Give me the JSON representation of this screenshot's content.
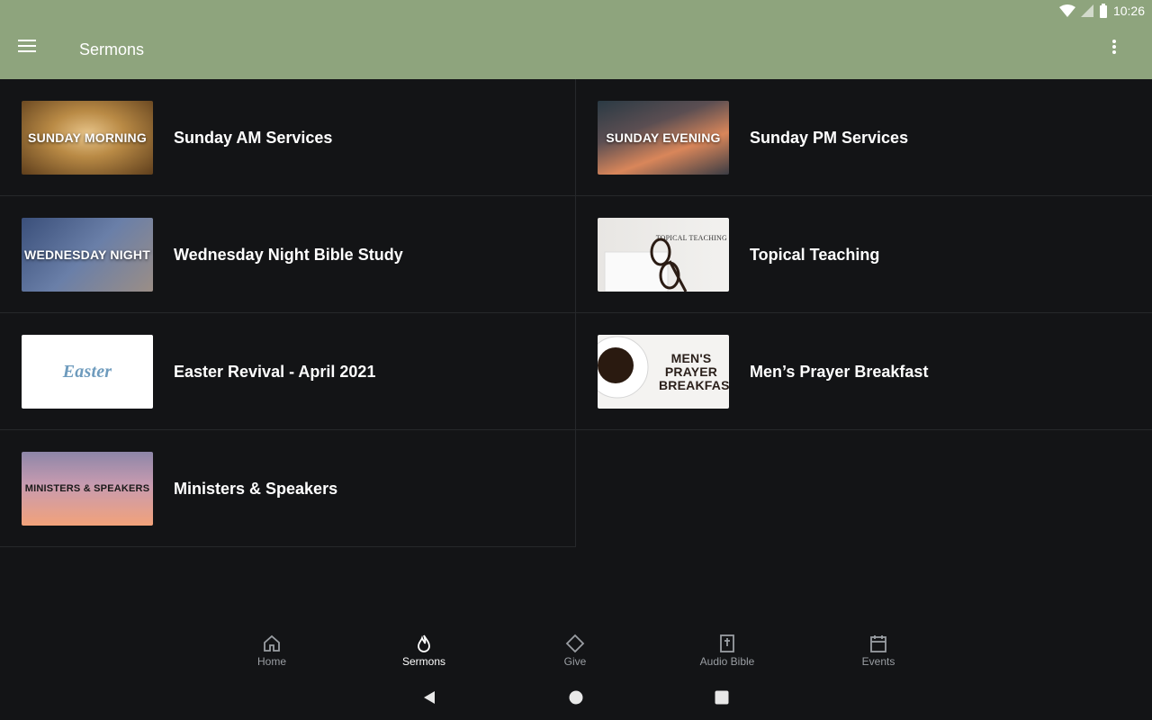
{
  "status": {
    "time": "10:26"
  },
  "appbar": {
    "title": "Sermons"
  },
  "items": [
    {
      "title": "Sunday AM Services",
      "thumb_text": "SUNDAY MORNING"
    },
    {
      "title": "Sunday PM Services",
      "thumb_text": "SUNDAY EVENING"
    },
    {
      "title": "Wednesday Night Bible Study",
      "thumb_text": "WEDNESDAY NIGHT"
    },
    {
      "title": "Topical Teaching",
      "thumb_text": "TOPICAL TEACHING"
    },
    {
      "title": "Easter Revival - April 2021",
      "thumb_text": "Easter"
    },
    {
      "title": "Men’s Prayer Breakfast",
      "thumb_text": "MEN'S PRAYER BREAKFAST"
    },
    {
      "title": "Ministers & Speakers",
      "thumb_text": "MINISTERS & SPEAKERS"
    }
  ],
  "bottom_nav": [
    {
      "label": "Home",
      "icon": "home-icon"
    },
    {
      "label": "Sermons",
      "icon": "flame-icon",
      "active": true
    },
    {
      "label": "Give",
      "icon": "diamond-icon"
    },
    {
      "label": "Audio Bible",
      "icon": "bible-icon"
    },
    {
      "label": "Events",
      "icon": "calendar-icon"
    }
  ],
  "colors": {
    "appbar": "#8ea47d",
    "background": "#131416"
  }
}
